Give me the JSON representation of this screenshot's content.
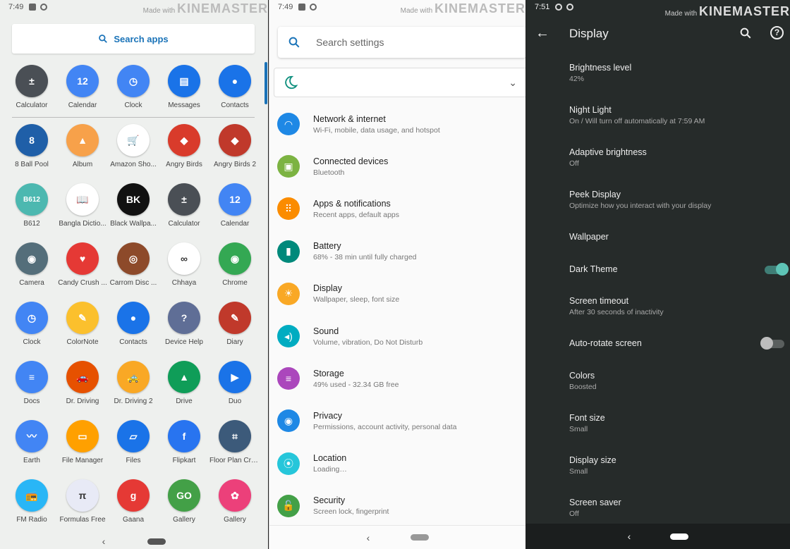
{
  "panel1": {
    "status_time": "7:49",
    "watermark_small": "Made with",
    "watermark_big": "KINEMASTER",
    "search_label": "Search apps",
    "pinned_apps": [
      {
        "label": "Calculator",
        "color": "#4a4f55",
        "glyph": "±"
      },
      {
        "label": "Calendar",
        "color": "#4285f4",
        "glyph": "12"
      },
      {
        "label": "Clock",
        "color": "#4285f4",
        "glyph": "◷"
      },
      {
        "label": "Messages",
        "color": "#1a73e8",
        "glyph": "▤"
      },
      {
        "label": "Contacts",
        "color": "#1a73e8",
        "glyph": "●"
      }
    ],
    "apps": [
      {
        "label": "8 Ball Pool",
        "color": "#1f5fa8",
        "glyph": "8"
      },
      {
        "label": "Album",
        "color": "#f7a14a",
        "glyph": "▲"
      },
      {
        "label": "Amazon Sho...",
        "color": "#ffffff",
        "glyph": "🛒",
        "dark": true
      },
      {
        "label": "Angry Birds",
        "color": "#d93b2b",
        "glyph": "◆"
      },
      {
        "label": "Angry Birds 2",
        "color": "#c0392b",
        "glyph": "◆"
      },
      {
        "label": "B612",
        "color": "#4cb8b0",
        "glyph": "B612"
      },
      {
        "label": "Bangla Dictio...",
        "color": "#ffffff",
        "glyph": "📖",
        "dark": true
      },
      {
        "label": "Black Wallpa...",
        "color": "#111111",
        "glyph": "BK"
      },
      {
        "label": "Calculator",
        "color": "#4a4f55",
        "glyph": "±"
      },
      {
        "label": "Calendar",
        "color": "#4285f4",
        "glyph": "12"
      },
      {
        "label": "Camera",
        "color": "#546e7a",
        "glyph": "◉"
      },
      {
        "label": "Candy Crush ...",
        "color": "#e53935",
        "glyph": "♥"
      },
      {
        "label": "Carrom Disc ...",
        "color": "#8d4a2a",
        "glyph": "◎"
      },
      {
        "label": "Chhaya",
        "color": "#ffffff",
        "glyph": "∞",
        "dark": true
      },
      {
        "label": "Chrome",
        "color": "#34a853",
        "glyph": "◉"
      },
      {
        "label": "Clock",
        "color": "#4285f4",
        "glyph": "◷"
      },
      {
        "label": "ColorNote",
        "color": "#fbc02d",
        "glyph": "✎"
      },
      {
        "label": "Contacts",
        "color": "#1a73e8",
        "glyph": "●"
      },
      {
        "label": "Device Help",
        "color": "#5f6e96",
        "glyph": "?"
      },
      {
        "label": "Diary",
        "color": "#c0392b",
        "glyph": "✎"
      },
      {
        "label": "Docs",
        "color": "#4285f4",
        "glyph": "≡"
      },
      {
        "label": "Dr. Driving",
        "color": "#e65100",
        "glyph": "🚗"
      },
      {
        "label": "Dr. Driving 2",
        "color": "#f9a825",
        "glyph": "🚕"
      },
      {
        "label": "Drive",
        "color": "#0f9d58",
        "glyph": "▲"
      },
      {
        "label": "Duo",
        "color": "#1a73e8",
        "glyph": "▶"
      },
      {
        "label": "Earth",
        "color": "#4285f4",
        "glyph": "〰"
      },
      {
        "label": "File Manager",
        "color": "#ffa000",
        "glyph": "▭"
      },
      {
        "label": "Files",
        "color": "#1a73e8",
        "glyph": "▱"
      },
      {
        "label": "Flipkart",
        "color": "#2874f0",
        "glyph": "f"
      },
      {
        "label": "Floor Plan Cre...",
        "color": "#3c5a7a",
        "glyph": "⌗"
      },
      {
        "label": "FM Radio",
        "color": "#29b6f6",
        "glyph": "📻"
      },
      {
        "label": "Formulas Free",
        "color": "#e8eaf6",
        "glyph": "π",
        "dark": true
      },
      {
        "label": "Gaana",
        "color": "#e53935",
        "glyph": "g"
      },
      {
        "label": "Gallery",
        "color": "#43a047",
        "glyph": "GO"
      },
      {
        "label": "Gallery",
        "color": "#ec407a",
        "glyph": "✿"
      }
    ]
  },
  "panel2": {
    "status_time": "7:49",
    "watermark_small": "Made with",
    "watermark_big": "KINEMASTER",
    "search_placeholder": "Search settings",
    "items": [
      {
        "title": "Network & internet",
        "subtitle": "Wi-Fi, mobile, data usage, and hotspot",
        "color": "#1e88e5",
        "icon": "wifi-icon",
        "glyph": "◠"
      },
      {
        "title": "Connected devices",
        "subtitle": "Bluetooth",
        "color": "#7cb342",
        "icon": "devices-icon",
        "glyph": "▣"
      },
      {
        "title": "Apps & notifications",
        "subtitle": "Recent apps, default apps",
        "color": "#fb8c00",
        "icon": "apps-icon",
        "glyph": "⠿"
      },
      {
        "title": "Battery",
        "subtitle": "68% - 38 min until fully charged",
        "color": "#00897b",
        "icon": "battery-icon",
        "glyph": "▮"
      },
      {
        "title": "Display",
        "subtitle": "Wallpaper, sleep, font size",
        "color": "#f9a825",
        "icon": "brightness-icon",
        "glyph": "☀"
      },
      {
        "title": "Sound",
        "subtitle": "Volume, vibration, Do Not Disturb",
        "color": "#00acc1",
        "icon": "volume-icon",
        "glyph": "◂)"
      },
      {
        "title": "Storage",
        "subtitle": "49% used - 32.34 GB free",
        "color": "#ab47bc",
        "icon": "storage-icon",
        "glyph": "≡"
      },
      {
        "title": "Privacy",
        "subtitle": "Permissions, account activity, personal data",
        "color": "#1e88e5",
        "icon": "privacy-icon",
        "glyph": "◉"
      },
      {
        "title": "Location",
        "subtitle": "Loading…",
        "color": "#26c6da",
        "icon": "location-icon",
        "glyph": "⦿"
      },
      {
        "title": "Security",
        "subtitle": "Screen lock, fingerprint",
        "color": "#43a047",
        "icon": "lock-icon",
        "glyph": "🔓"
      }
    ]
  },
  "panel3": {
    "status_time": "7:51",
    "watermark_small": "Made with",
    "watermark_big": "KINEMASTER",
    "title": "Display",
    "items": [
      {
        "title": "Brightness level",
        "subtitle": "42%"
      },
      {
        "title": "Night Light",
        "subtitle": "On / Will turn off automatically at 7:59 AM"
      },
      {
        "title": "Adaptive brightness",
        "subtitle": "Off"
      },
      {
        "title": "Peek Display",
        "subtitle": "Optimize how you interact with your display"
      },
      {
        "title": "Wallpaper",
        "subtitle": ""
      },
      {
        "title": "Dark Theme",
        "subtitle": "",
        "toggle": true
      },
      {
        "title": "Screen timeout",
        "subtitle": "After 30 seconds of inactivity"
      },
      {
        "title": "Auto-rotate screen",
        "subtitle": "",
        "toggle": false
      },
      {
        "title": "Colors",
        "subtitle": "Boosted"
      },
      {
        "title": "Font size",
        "subtitle": "Small"
      },
      {
        "title": "Display size",
        "subtitle": "Small"
      },
      {
        "title": "Screen saver",
        "subtitle": "Off"
      }
    ],
    "accent": "#5ec4b6"
  }
}
